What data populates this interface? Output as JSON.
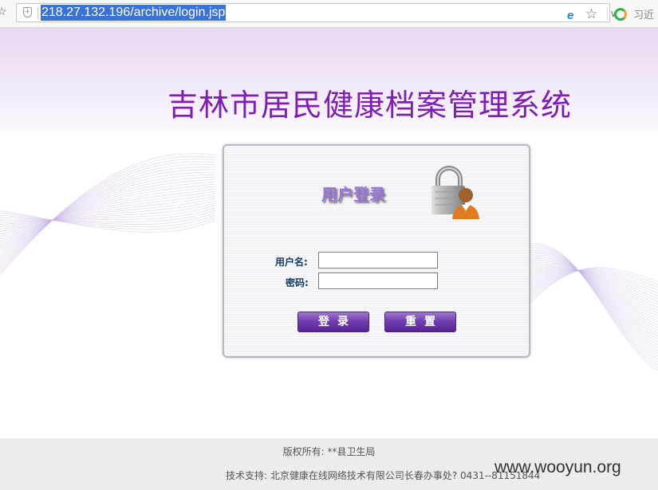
{
  "browser": {
    "url": "218.27.132.196/archive/login.jsp",
    "search_text": "习近"
  },
  "header": {
    "title": "吉林市居民健康档案管理系统"
  },
  "login": {
    "title": "用户登录",
    "username_label": "用户名:",
    "password_label": "密码:",
    "username_value": "",
    "password_value": "",
    "login_button": "登录",
    "reset_button": "重置"
  },
  "footer": {
    "copyright": "版权所有: **县卫生局",
    "support": "技术支持: 北京健康在线网络技术有限公司长春办事处? 0431--81151844"
  },
  "watermark": "www.wooyun.org",
  "colors": {
    "title_purple": "#7e1fb3",
    "button_purple": "#6a36a8",
    "address_highlight": "#3a72d8"
  }
}
